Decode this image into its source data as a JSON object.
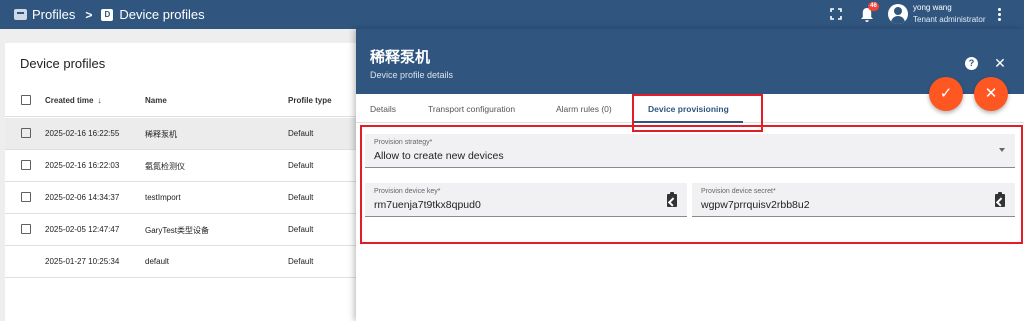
{
  "topbar": {
    "breadcrumb_root": "Profiles",
    "breadcrumb_separator": ">",
    "breadcrumb_current_icon_letter": "D",
    "breadcrumb_current": "Device profiles",
    "notification_count": "46",
    "user_name": "yong wang",
    "user_role": "Tenant administrator"
  },
  "list": {
    "title": "Device profiles",
    "columns": {
      "created": "Created time",
      "sort_indicator": "↓",
      "name": "Name",
      "type": "Profile type"
    },
    "rows": [
      {
        "created": "2025-02-16 16:22:55",
        "name": "稀释泵机",
        "type": "Default"
      },
      {
        "created": "2025-02-16 16:22:03",
        "name": "氨氮检测仪",
        "type": "Default"
      },
      {
        "created": "2025-02-06 14:34:37",
        "name": "testImport",
        "type": "Default"
      },
      {
        "created": "2025-02-05 12:47:47",
        "name": "GaryTest类型设备",
        "type": "Default"
      },
      {
        "created": "2025-01-27 10:25:34",
        "name": "default",
        "type": "Default"
      }
    ]
  },
  "details": {
    "entity_name": "稀释泵机",
    "subtitle": "Device profile details",
    "help_icon_glyph": "?",
    "close_icon_glyph": "✕",
    "apply_icon_glyph": "✓",
    "cancel_icon_glyph": "✕",
    "tabs": [
      {
        "label": "Details"
      },
      {
        "label": "Transport configuration"
      },
      {
        "label": "Alarm rules (0)"
      },
      {
        "label": "Device provisioning"
      }
    ],
    "provision_strategy": {
      "label": "Provision strategy*",
      "value": "Allow to create new devices"
    },
    "provision_key": {
      "label": "Provision device key*",
      "value": "rm7uenja7t9tkx8qpud0"
    },
    "provision_secret": {
      "label": "Provision device secret*",
      "value": "wgpw7prrquisv2rbb8u2"
    }
  },
  "colors": {
    "primary": "#305680",
    "accent": "#ff5722",
    "highlight": "#e31c25"
  }
}
